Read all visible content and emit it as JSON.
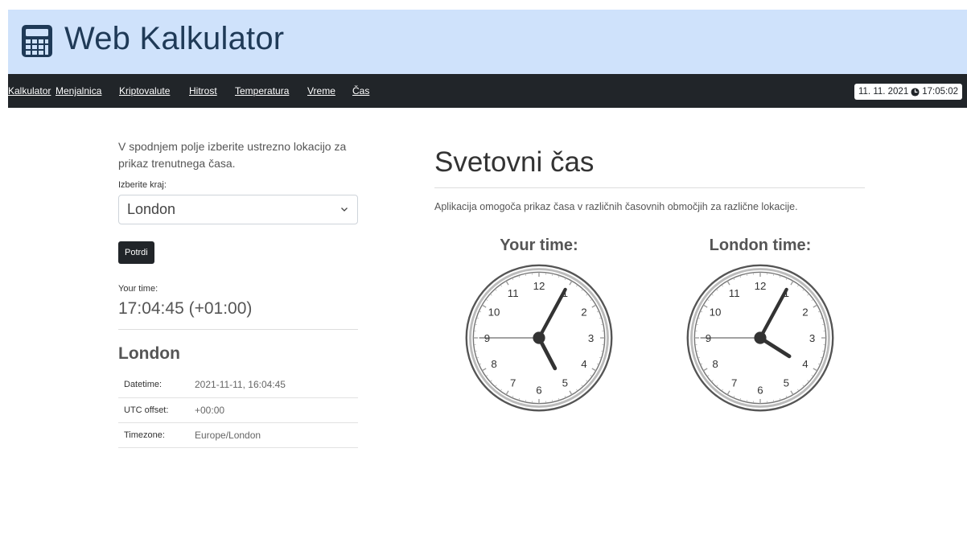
{
  "app": {
    "title": "Web Kalkulator",
    "logo_icon": "calculator-icon"
  },
  "nav": {
    "items": [
      {
        "label": "Kalkulator"
      },
      {
        "label": "Menjalnica"
      },
      {
        "label": "Kriptovalute"
      },
      {
        "label": "Hitrost"
      },
      {
        "label": "Temperatura"
      },
      {
        "label": "Vreme"
      },
      {
        "label": "Čas"
      }
    ],
    "datetime": {
      "date": "11. 11. 2021",
      "time": "17:05:02",
      "icon": "clock-icon"
    }
  },
  "form": {
    "intro": "V spodnjem polje izberite ustrezno lokacijo za prikaz trenutnega časa.",
    "select_label": "Izberite kraj:",
    "selected_city": "London",
    "submit_label": "Potrdi"
  },
  "your_time": {
    "label": "Your time:",
    "value": "17:04:45 (+01:00)"
  },
  "city": {
    "name": "London",
    "rows": [
      {
        "key": "Datetime:",
        "value": "2021-11-11, 16:04:45"
      },
      {
        "key": "UTC offset:",
        "value": "+00:00"
      },
      {
        "key": "Timezone:",
        "value": "Europe/London"
      }
    ]
  },
  "world": {
    "title": "Svetovni čas",
    "description": "Aplikacija omogoča prikaz časa v različnih časovnih območjih za različne lokacije."
  },
  "clocks": [
    {
      "title": "Your time:",
      "hours": 17,
      "minutes": 4,
      "seconds": 45
    },
    {
      "title": "London time:",
      "hours": 16,
      "minutes": 4,
      "seconds": 45
    }
  ],
  "colors": {
    "header_bg": "#cfe2fb",
    "navbar_bg": "#212529",
    "title_text": "#1f3a57"
  }
}
